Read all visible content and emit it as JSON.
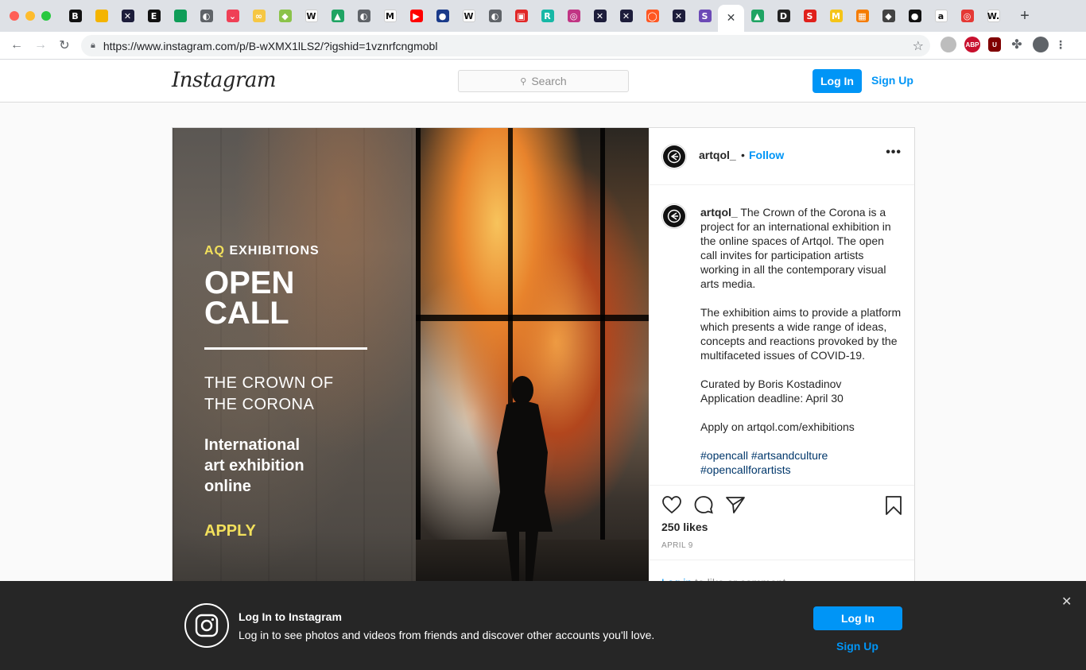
{
  "browser": {
    "tabs": [
      {
        "icon": "b-icon",
        "glyph": "B",
        "color": "#111111"
      },
      {
        "icon": "slides-icon",
        "glyph": "",
        "color": "#f4b400"
      },
      {
        "icon": "feather-icon",
        "glyph": "✕",
        "color": "#1d1d3b"
      },
      {
        "icon": "e-icon",
        "glyph": "E",
        "color": "#111111"
      },
      {
        "icon": "sheets-icon",
        "glyph": "",
        "color": "#0f9d58"
      },
      {
        "icon": "globe-icon",
        "glyph": "◐",
        "color": "#5f6368"
      },
      {
        "icon": "pocket-icon",
        "glyph": "⌄",
        "color": "#ef4056"
      },
      {
        "icon": "cc-icon",
        "glyph": "∞",
        "color": "#f6c744"
      },
      {
        "icon": "bookmark-green-icon",
        "glyph": "◆",
        "color": "#8bc34a"
      },
      {
        "icon": "wikipedia-icon",
        "glyph": "W",
        "color": "#ffffff"
      },
      {
        "icon": "drive-icon",
        "glyph": "▲",
        "color": "#1fa463"
      },
      {
        "icon": "globe-icon",
        "glyph": "◐",
        "color": "#5f6368"
      },
      {
        "icon": "medium-icon",
        "glyph": "M",
        "color": "#ffffff"
      },
      {
        "icon": "youtube-icon",
        "glyph": "▶",
        "color": "#ff0000"
      },
      {
        "icon": "blue-circle-icon",
        "glyph": "●",
        "color": "#1a3a8a"
      },
      {
        "icon": "wikipedia-icon",
        "glyph": "W",
        "color": "#ffffff"
      },
      {
        "icon": "globe-icon",
        "glyph": "◐",
        "color": "#5f6368"
      },
      {
        "icon": "flipboard-icon",
        "glyph": "▣",
        "color": "#e12828"
      },
      {
        "icon": "r-icon",
        "glyph": "R",
        "color": "#17b8a6"
      },
      {
        "icon": "instagram-icon",
        "glyph": "◎",
        "color": "#c13584"
      },
      {
        "icon": "feather-icon",
        "glyph": "✕",
        "color": "#1d1d3b"
      },
      {
        "icon": "feather-icon",
        "glyph": "✕",
        "color": "#1d1d3b"
      },
      {
        "icon": "drop-icon",
        "glyph": "◯",
        "color": "#ff5722"
      },
      {
        "icon": "feather-icon",
        "glyph": "✕",
        "color": "#1d1d3b"
      },
      {
        "icon": "s-purple-icon",
        "glyph": "S",
        "color": "#6c4ab6"
      },
      {
        "icon": "close-icon",
        "glyph": "✕",
        "color": "#ffffff",
        "active": true
      },
      {
        "icon": "drive-icon",
        "glyph": "▲",
        "color": "#1fa463"
      },
      {
        "icon": "d-icon",
        "glyph": "D",
        "color": "#222222"
      },
      {
        "icon": "s-red-icon",
        "glyph": "S",
        "color": "#e0201b"
      },
      {
        "icon": "m-yellow-icon",
        "glyph": "M",
        "color": "#f5c518"
      },
      {
        "icon": "orange-grid-icon",
        "glyph": "▦",
        "color": "#f57c00"
      },
      {
        "icon": "diamond-icon",
        "glyph": "◆",
        "color": "#424242"
      },
      {
        "icon": "dark-circle-icon",
        "glyph": "●",
        "color": "#111111"
      },
      {
        "icon": "amazon-icon",
        "glyph": "a",
        "color": "#ffffff"
      },
      {
        "icon": "target-icon",
        "glyph": "◎",
        "color": "#e53935"
      },
      {
        "icon": "w-dot-icon",
        "glyph": "W.",
        "color": "#ffffff"
      }
    ],
    "new_tab": "+",
    "url": "https://www.instagram.com/p/B-wXMX1lLS2/?igshid=1vznrfcngmobl"
  },
  "header": {
    "logo": "Instagram",
    "search_placeholder": "Search",
    "login": "Log In",
    "signup": "Sign Up"
  },
  "post_image": {
    "brand_a": "AQ",
    "brand_b": "EXHIBITIONS",
    "line1": "OPEN",
    "line2": "CALL",
    "crown1": "THE CROWN OF",
    "crown2": "THE CORONA",
    "intl1": "International",
    "intl2": "art exhibition",
    "intl3": "online",
    "apply": "APPLY"
  },
  "post": {
    "username": "artqol_",
    "dot": "•",
    "follow": "Follow",
    "more": "•••",
    "caption_user": "artqol_",
    "caption_p1": "The Crown of the Corona is a project for an international exhibition in the online spaces of Artqol. The open call invites for participation artists working in all the contemporary visual arts media.",
    "caption_p2": "The exhibition aims to provide a platform which presents a wide range of ideas, concepts and reactions provoked by the multifaceted issues of COVID-19.",
    "caption_p3a": "Curated by Boris Kostadinov",
    "caption_p3b": "Application deadline: April 30",
    "caption_p4": "Apply on artqol.com/exhibitions",
    "hashtags1": "#opencall #artsandculture",
    "hashtags2": "#opencallforartists",
    "likes": "250 likes",
    "date": "APRIL 9",
    "login_link": "Log in",
    "login_rest": "to like or comment."
  },
  "banner": {
    "title": "Log In to Instagram",
    "subtitle": "Log in to see photos and videos from friends and discover other accounts you'll love.",
    "login": "Log In",
    "signup": "Sign Up",
    "close": "✕"
  },
  "colors": {
    "accent": "#0095f6",
    "banner_bg": "#262626"
  }
}
